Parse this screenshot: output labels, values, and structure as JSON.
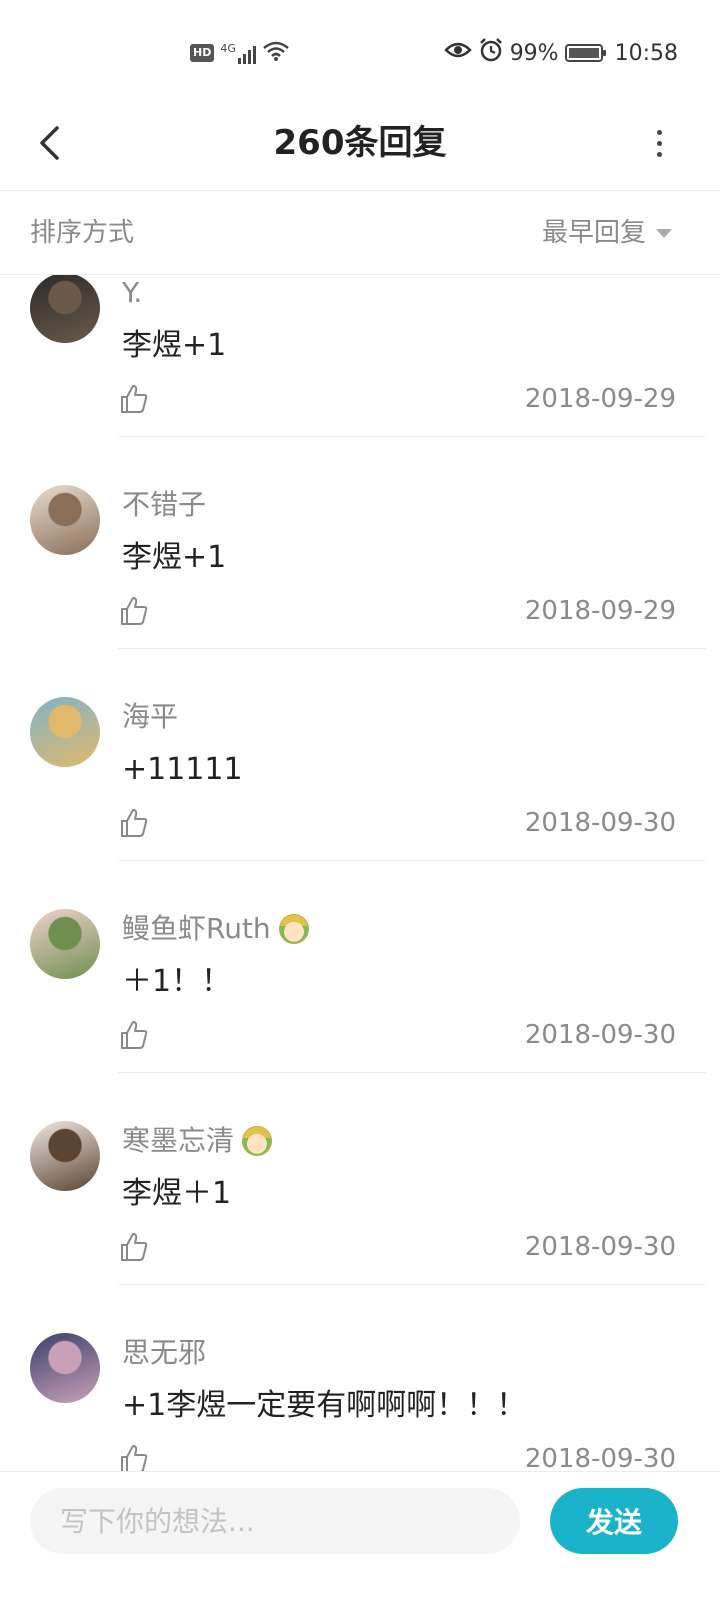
{
  "status_bar": {
    "hd_label": "HD",
    "network_label": "4G",
    "battery": "99%",
    "battery_level": 0.99,
    "time": "10:58"
  },
  "header": {
    "title": "260条回复",
    "back_icon": "back-arrow-icon",
    "more_icon": "more-vertical-icon"
  },
  "sort": {
    "label": "排序方式",
    "selected": "最早回复"
  },
  "comments": [
    {
      "name": "Y.",
      "text": "李煜+1",
      "date": "2018-09-29",
      "has_badge": false,
      "avatar_colors": [
        "#2a2a2a",
        "#6b5a4a"
      ]
    },
    {
      "name": "不错子",
      "text": "李煜+1",
      "date": "2018-09-29",
      "has_badge": false,
      "avatar_colors": [
        "#e9ded0",
        "#8a6e58"
      ]
    },
    {
      "name": "海平",
      "text": "+11111",
      "date": "2018-09-30",
      "has_badge": false,
      "avatar_colors": [
        "#7fb4c9",
        "#e2b86a"
      ]
    },
    {
      "name": "鳗鱼虾Ruth",
      "text": "＋1！！",
      "date": "2018-09-30",
      "has_badge": true,
      "avatar_colors": [
        "#f0d2cd",
        "#6f8f4f"
      ]
    },
    {
      "name": "寒墨忘清",
      "text": "李煜＋1",
      "date": "2018-09-30",
      "has_badge": true,
      "avatar_colors": [
        "#f2e8e4",
        "#5b4432"
      ]
    },
    {
      "name": "思无邪",
      "text": "+1李煜一定要有啊啊啊！！！",
      "date": "2018-09-30",
      "has_badge": false,
      "avatar_colors": [
        "#3c3f6e",
        "#c9a0b8"
      ]
    }
  ],
  "input": {
    "placeholder": "写下你的想法...",
    "send_label": "发送"
  },
  "colors": {
    "accent": "#1bb3c9",
    "muted_text": "#8a8a8a",
    "divider": "#ececec"
  }
}
